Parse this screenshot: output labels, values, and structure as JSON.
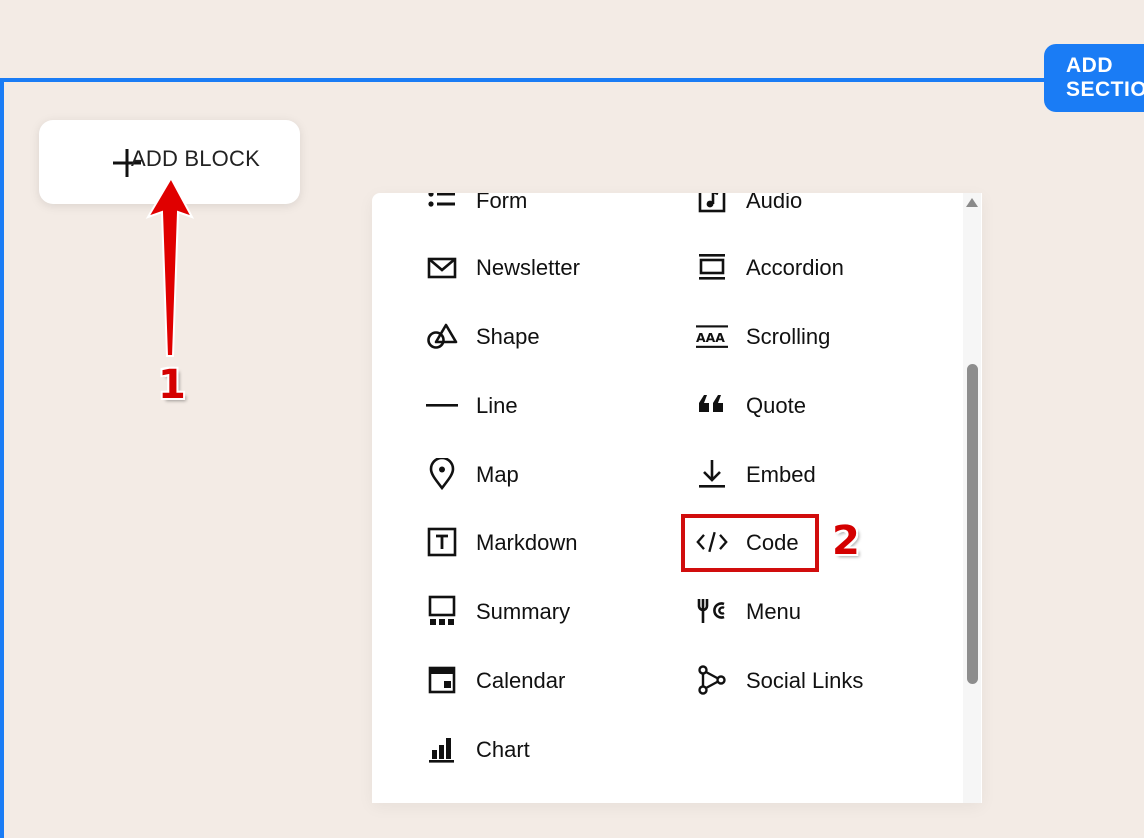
{
  "toolbar": {
    "add_section_label": "ADD SECTION"
  },
  "add_block": {
    "label": "ADD BLOCK"
  },
  "blocks_left": [
    {
      "label": "Form",
      "icon": "form-icon"
    },
    {
      "label": "Newsletter",
      "icon": "newsletter-icon"
    },
    {
      "label": "Shape",
      "icon": "shape-icon"
    },
    {
      "label": "Line",
      "icon": "line-icon"
    },
    {
      "label": "Map",
      "icon": "map-pin-icon"
    },
    {
      "label": "Markdown",
      "icon": "markdown-icon"
    },
    {
      "label": "Summary",
      "icon": "summary-icon"
    },
    {
      "label": "Calendar",
      "icon": "calendar-icon"
    },
    {
      "label": "Chart",
      "icon": "chart-icon"
    }
  ],
  "blocks_right": [
    {
      "label": "Audio",
      "icon": "audio-icon"
    },
    {
      "label": "Accordion",
      "icon": "accordion-icon"
    },
    {
      "label": "Scrolling",
      "icon": "scrolling-icon"
    },
    {
      "label": "Quote",
      "icon": "quote-icon"
    },
    {
      "label": "Embed",
      "icon": "embed-icon"
    },
    {
      "label": "Code",
      "icon": "code-icon"
    },
    {
      "label": "Menu",
      "icon": "menu-icon"
    },
    {
      "label": "Social Links",
      "icon": "social-links-icon"
    }
  ],
  "annotations": {
    "step1": "1",
    "step2": "2"
  },
  "colors": {
    "accent": "#1a7cf5",
    "annotation": "#d40000",
    "background": "#f3ebe5"
  }
}
